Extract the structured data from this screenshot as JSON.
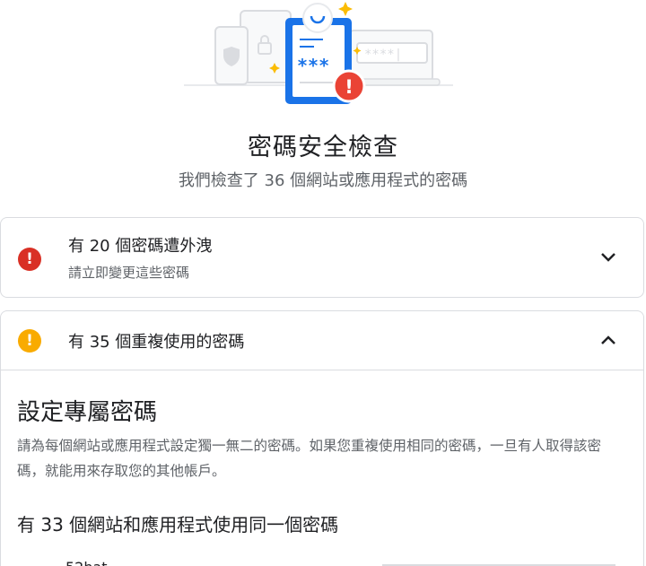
{
  "header": {
    "title": "密碼安全檢查",
    "subtitle": "我們檢查了 36 個網站或應用程式的密碼"
  },
  "illustration": {
    "card_text": "***",
    "field_text": "****|",
    "alert_mark": "!"
  },
  "compromised": {
    "title": "有 20 個密碼遭外洩",
    "subtitle": "請立即變更這些密碼",
    "icon": "error-icon",
    "icon_glyph": "!",
    "expanded": false
  },
  "reused": {
    "title": "有 35 個重複使用的密碼",
    "icon": "warning-icon",
    "icon_glyph": "!",
    "expanded": true,
    "section_title": "設定專屬密碼",
    "section_desc": "請為每個網站或應用程式設定獨一無二的密碼。如果您重複使用相同的密碼，一旦有人取得該密碼，就能用來存取您的其他帳戶。",
    "group_title": "有 33 個網站和應用程式使用同一個密碼",
    "first_entry_partial": "52hat"
  },
  "colors": {
    "error": "#d93025",
    "warning": "#f9ab00",
    "accent": "#1a73e8"
  }
}
